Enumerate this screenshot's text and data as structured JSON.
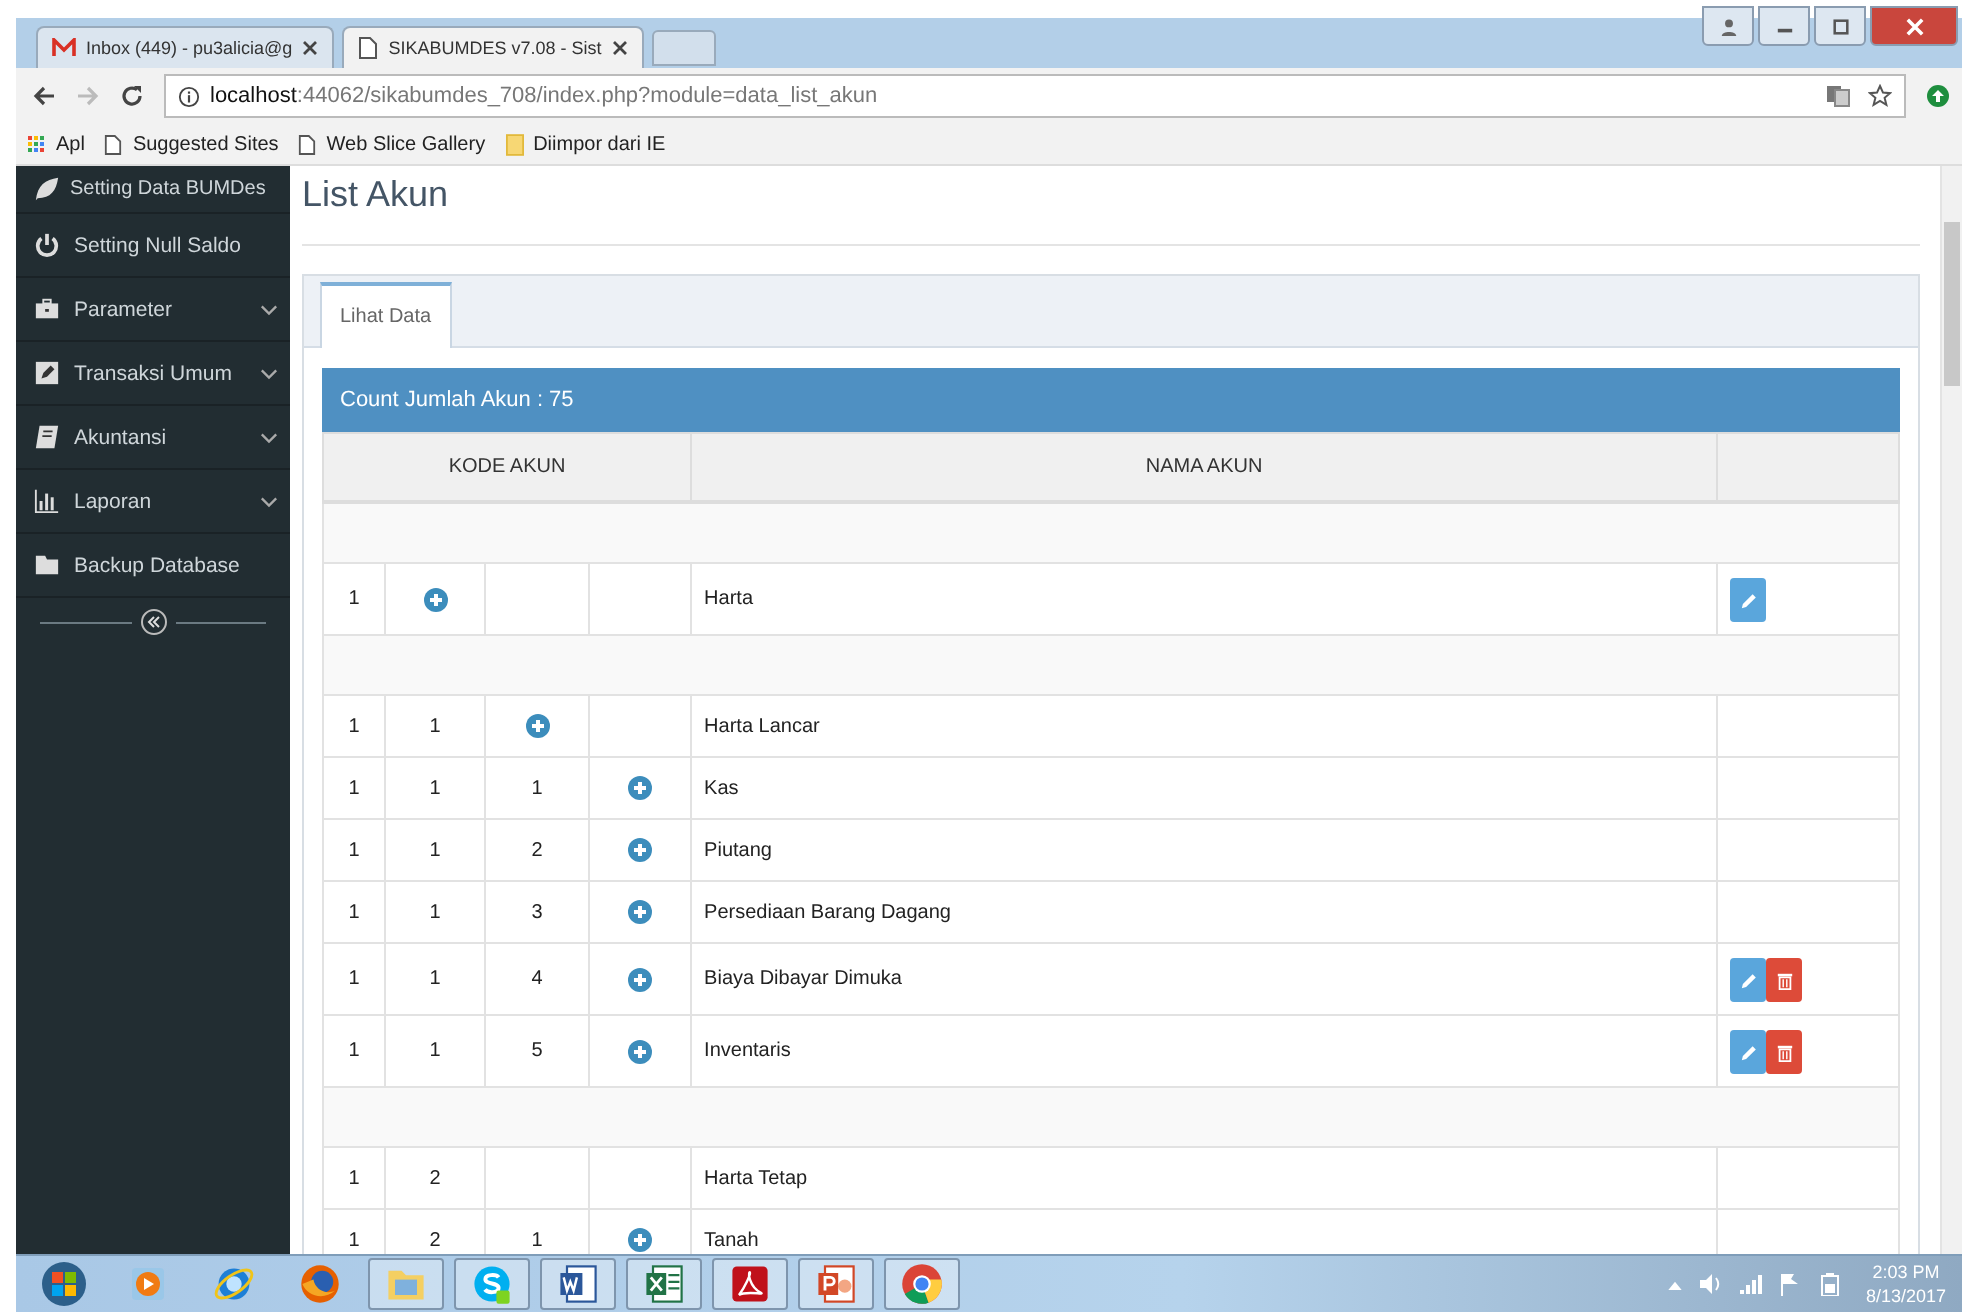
{
  "browser": {
    "tabs": [
      {
        "title": "Inbox (449) - pu3alicia@g",
        "kind": "mail",
        "selected": false
      },
      {
        "title": "SIKABUMDES v7.08 - Sist",
        "kind": "page",
        "selected": true
      }
    ],
    "address": {
      "host": "localhost",
      "path": ":44062/sikabumdes_708/index.php?module=data_list_akun"
    },
    "bookmarks": [
      {
        "label": "Apl",
        "kind": "apps"
      },
      {
        "label": "Suggested Sites",
        "kind": "page"
      },
      {
        "label": "Web Slice Gallery",
        "kind": "page"
      },
      {
        "label": "Diimpor dari IE",
        "kind": "folder"
      }
    ]
  },
  "sidebar": {
    "items": [
      {
        "label": "Setting Data BUMDes",
        "kind": "leaf",
        "expandable": false
      },
      {
        "label": "Setting Null Saldo",
        "kind": "power",
        "expandable": false
      },
      {
        "label": "Parameter",
        "kind": "briefcase",
        "expandable": true
      },
      {
        "label": "Transaksi Umum",
        "kind": "edit",
        "expandable": true
      },
      {
        "label": "Akuntansi",
        "kind": "book",
        "expandable": true
      },
      {
        "label": "Laporan",
        "kind": "chart",
        "expandable": true
      },
      {
        "label": "Backup Database",
        "kind": "folder",
        "expandable": false
      }
    ]
  },
  "page": {
    "title": "List Akun",
    "tabs": [
      {
        "label": "Lihat Data",
        "selected": true
      }
    ],
    "panel_heading": "Count Jumlah Akun : 75",
    "table": {
      "columns": [
        {
          "label": "KODE AKUN"
        },
        {
          "label": "NAMA AKUN"
        }
      ],
      "rows": [
        {
          "kind": "spacer"
        },
        {
          "kind": "account",
          "code": [
            {
              "kind": "text",
              "text": "1"
            },
            {
              "kind": "add"
            },
            {
              "kind": "empty"
            },
            {
              "kind": "empty"
            }
          ],
          "name": "Harta",
          "actions": [
            {
              "kind": "edit"
            }
          ]
        },
        {
          "kind": "spacer"
        },
        {
          "kind": "account",
          "code": [
            {
              "kind": "text",
              "text": "1"
            },
            {
              "kind": "text",
              "text": "1"
            },
            {
              "kind": "add"
            },
            {
              "kind": "empty"
            }
          ],
          "name": "Harta Lancar",
          "actions": []
        },
        {
          "kind": "account",
          "code": [
            {
              "kind": "text",
              "text": "1"
            },
            {
              "kind": "text",
              "text": "1"
            },
            {
              "kind": "text",
              "text": "1"
            },
            {
              "kind": "add"
            }
          ],
          "name": "Kas",
          "actions": []
        },
        {
          "kind": "account",
          "code": [
            {
              "kind": "text",
              "text": "1"
            },
            {
              "kind": "text",
              "text": "1"
            },
            {
              "kind": "text",
              "text": "2"
            },
            {
              "kind": "add"
            }
          ],
          "name": "Piutang",
          "actions": []
        },
        {
          "kind": "account",
          "code": [
            {
              "kind": "text",
              "text": "1"
            },
            {
              "kind": "text",
              "text": "1"
            },
            {
              "kind": "text",
              "text": "3"
            },
            {
              "kind": "add"
            }
          ],
          "name": "Persediaan Barang Dagang",
          "actions": []
        },
        {
          "kind": "account",
          "code": [
            {
              "kind": "text",
              "text": "1"
            },
            {
              "kind": "text",
              "text": "1"
            },
            {
              "kind": "text",
              "text": "4"
            },
            {
              "kind": "add"
            }
          ],
          "name": "Biaya Dibayar Dimuka",
          "actions": [
            {
              "kind": "edit"
            },
            {
              "kind": "delete"
            }
          ]
        },
        {
          "kind": "account",
          "code": [
            {
              "kind": "text",
              "text": "1"
            },
            {
              "kind": "text",
              "text": "1"
            },
            {
              "kind": "text",
              "text": "5"
            },
            {
              "kind": "add"
            }
          ],
          "name": "Inventaris",
          "actions": [
            {
              "kind": "edit"
            },
            {
              "kind": "delete"
            }
          ]
        },
        {
          "kind": "spacer"
        },
        {
          "kind": "account",
          "code": [
            {
              "kind": "text",
              "text": "1"
            },
            {
              "kind": "text",
              "text": "2"
            },
            {
              "kind": "empty"
            },
            {
              "kind": "empty"
            }
          ],
          "name": "Harta Tetap",
          "actions": []
        },
        {
          "kind": "account",
          "code": [
            {
              "kind": "text",
              "text": "1"
            },
            {
              "kind": "text",
              "text": "2"
            },
            {
              "kind": "text",
              "text": "1"
            },
            {
              "kind": "add"
            }
          ],
          "name": "Tanah",
          "actions": []
        }
      ]
    }
  },
  "taskbar": {
    "apps": [
      {
        "kind": "media",
        "open": false
      },
      {
        "kind": "ie",
        "open": false
      },
      {
        "kind": "firefox",
        "open": false
      },
      {
        "kind": "explorer",
        "open": true
      },
      {
        "kind": "skype",
        "open": true
      },
      {
        "kind": "word",
        "open": true
      },
      {
        "kind": "excel",
        "open": true
      },
      {
        "kind": "pdf",
        "open": true
      },
      {
        "kind": "powerpoint",
        "open": true
      },
      {
        "kind": "chrome",
        "open": true
      }
    ],
    "time": "2:03 PM",
    "date": "8/13/2017"
  }
}
